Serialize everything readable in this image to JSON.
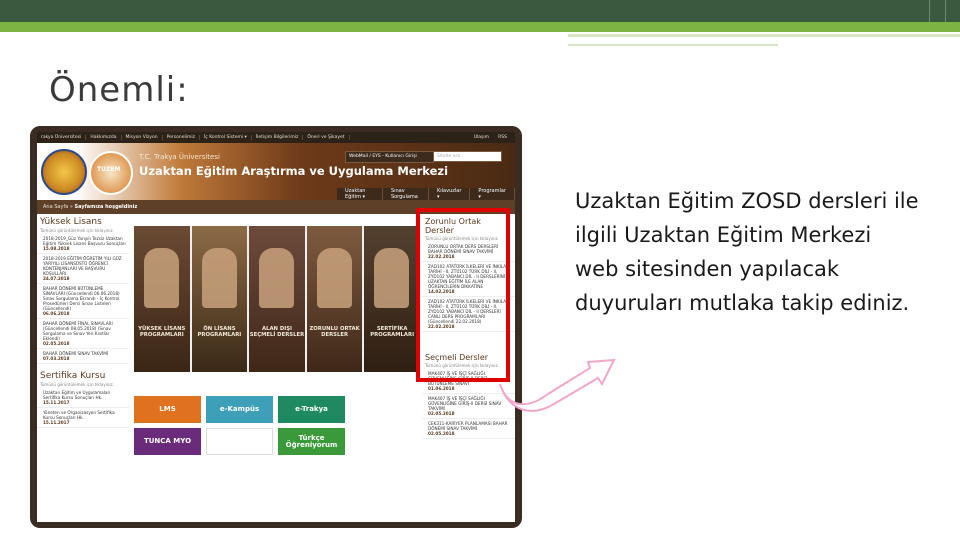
{
  "slide": {
    "title": "Önemli:",
    "note": "Uzaktan Eğitim ZOSD dersleri ile ilgili Uzaktan Eğitim Merkezi web sitesinden yapılacak duyuruları mutlaka takip ediniz."
  },
  "colors": {
    "top_bar": "#3a5a40",
    "accent_green": "#7cb342",
    "highlight_box": "#e10000",
    "arrow": "#f7c6dd"
  },
  "site": {
    "nav_items": [
      "rakya Üniversitesi",
      "Hakkımızda",
      "Misyon Vizyon",
      "Personelimiz",
      "İç Kontrol Sistemi ▾",
      "İletişim Bilgilerimiz",
      "Öneri ve Şikayet"
    ],
    "nav_right": [
      "Ulaşım",
      "RSS"
    ],
    "university": "T.C. Trakya Üniversitesi",
    "center": "Uzaktan Eğitim Araştırma ve Uygulama Merkezi",
    "logo2_text": "TUZEM",
    "webmail": "WebMail / EYS - Kullanıcı Girişi",
    "search_placeholder": "Sitede ara",
    "menu": [
      "Uzaktan Eğitim ▾",
      "Sınav Sorgulama",
      "Kılavuzlar ▾",
      "Programlar ▾"
    ],
    "breadcrumb": "Ana Sayfa »",
    "welcome": "Sayfamıza hoşgeldiniz",
    "left_title": "Yüksek Lisans",
    "left_note": "Tümünü görüntülemek için tıklayınız.",
    "left_news": [
      {
        "text": "2018-2019_Güz Yarıyılı Tezsiz Uzaktan Eğitim Yüksek Lisans Başvuru Sonuçları",
        "date": "15.08.2018"
      },
      {
        "text": "2018-2019 EĞİTİM ÖĞRETİM YILI GÜZ YARIYILI LİSANSÜSTÜ ÖĞRENCİ KONTENJANLARI VE BAŞVURU KOŞULLARI",
        "date": "24.07.2018"
      },
      {
        "text": "BAHAR DÖNEMİ BÜTÜNLEME SINAVLARI (Güncellendi 06.06.2018) Sınav Sorgulama Ekrandı - İç Kontrol Prosedürleri Dersi Sınav Listeleri (Güncellendi)",
        "date": "06.06.2018"
      },
      {
        "text": "BAHAR DÖNEMİ FİNAL SINAVLARI (Güncellendi 08.05.2018) (Sınav Sorgulama ve Sınav Yeri Kısıtlar Eklendi)",
        "date": "02.05.2018"
      },
      {
        "text": "BAHAR DÖNEMİ SINAV TAKVİMİ",
        "date": "07.03.2018"
      }
    ],
    "left_title2": "Sertifika Kursu",
    "left_news2": [
      {
        "text": "Uzaktan Eğitim ve Uygulamaları Sertifika Kursu Sonuçları Hk.",
        "date": "15.11.2017"
      },
      {
        "text": "Yöneten ve Organizasyon Sertifika Kursu Sonuçları Hk.",
        "date": "15.11.2017"
      }
    ],
    "banners": [
      "YÜKSEK LİSANS PROGRAMLARI",
      "ÖN LİSANS PROGRAMLARI",
      "ALAN DIŞI SEÇMELİ DERSLER",
      "ZORUNLU ORTAK DERSLER",
      "SERTİFİKA PROGRAMLARI"
    ],
    "tiles": [
      {
        "label": "LMS",
        "color": "#e0711f"
      },
      {
        "label": "e-Kampüs",
        "color": "#3e9fb8"
      },
      {
        "label": "e-Trakya",
        "color": "#1f8a61"
      },
      {
        "label": "TUNCA MYO",
        "color": "#6a2b7a"
      },
      {
        "label": "",
        "color": "#ffffff"
      },
      {
        "label": "Türkçe Öğreniyorum",
        "color": "#3a9a3a"
      }
    ],
    "right_title": "Zorunlu Ortak Dersler",
    "right_note": "Tümünü görüntülemek için tıklayınız.",
    "right_news": [
      {
        "text": "ZORUNLU ORTAK DERS DERSLERİ BAHAR DÖNEMİ SINAV TAKVİMİ",
        "date": "22.02.2018"
      },
      {
        "text": "ZAD102 ATATÜRK İLKELERİ VE İNKILAP TARİHİ - II, ZTÜ102 TÜRK DİLİ - II, ZYD102 YABANCI DİL - II DERSLERİNİ UZAKTAN EĞİTİM İLE ALAN ÖĞRENCİLERİN DİKKATİNE",
        "date": "14.02.2018"
      },
      {
        "text": "ZAD102 ATATÜRK İLKELERİ VE İNKILAP TARİHİ - II, ZTÜ102 TÜRK DİLİ - II, ZYD102 YABANCI DİL - II DERSLERİ CANLI DERS PROGRAMLARI (Güncellendi 22.02.2018)",
        "date": "22.02.2018"
      }
    ],
    "right_title2": "Seçmeli Dersler",
    "right_news2": [
      {
        "text": "MAK407 İŞ VE İŞÇİ SAĞLIĞI GÜVENLİĞİNE GİRİŞ-II DERSİ BÜTÜNLEME SINAVI",
        "date": "01.06.2018"
      },
      {
        "text": "MAK407 İŞ VE İŞÇİ SAĞLIĞI GÜVENLİĞİNE GİRİŞ-II DERSİ SINAV TAKVİMİ",
        "date": "02.05.2018"
      },
      {
        "text": "CEK311-KARİYER PLANLAMASI BAHAR DÖNEMİ SINAV TAKVİMİ",
        "date": "02.05.2018"
      }
    ]
  }
}
